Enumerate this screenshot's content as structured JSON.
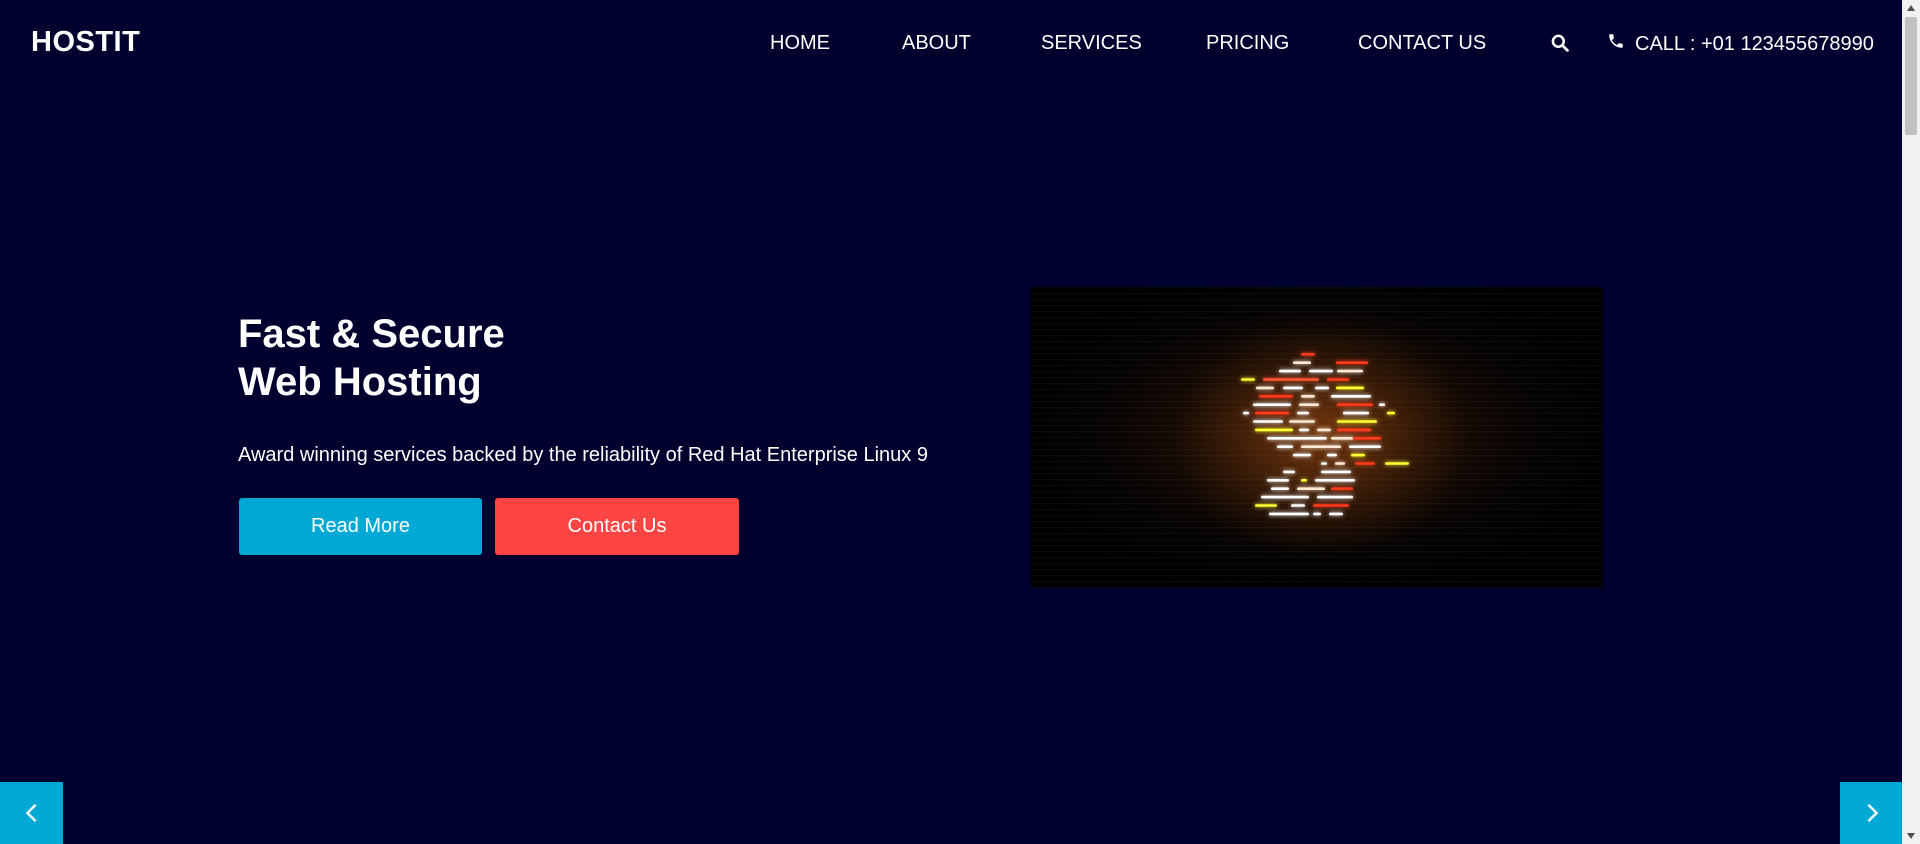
{
  "header": {
    "brand": "HOSTIT",
    "nav": [
      "HOME",
      "ABOUT",
      "SERVICES",
      "PRICING",
      "CONTACT US"
    ],
    "search_icon": "search-icon",
    "call_icon": "phone-icon",
    "call_text": "CALL : +01 123455678990"
  },
  "hero": {
    "title_line1": "Fast & Secure",
    "title_line2": "Web Hosting",
    "subtitle": "Award winning services backed by the reliability of Red Hat Enterprise Linux 9",
    "read_more_label": "Read More",
    "contact_label": "Contact Us",
    "image_icon": "glowing-code-illustration"
  },
  "carousel": {
    "prev_icon": "chevron-left-icon",
    "next_icon": "chevron-right-icon"
  },
  "colors": {
    "background": "#00002e",
    "primary_button": "#00a8d6",
    "secondary_button": "#ff4444",
    "text": "#ffffff"
  }
}
